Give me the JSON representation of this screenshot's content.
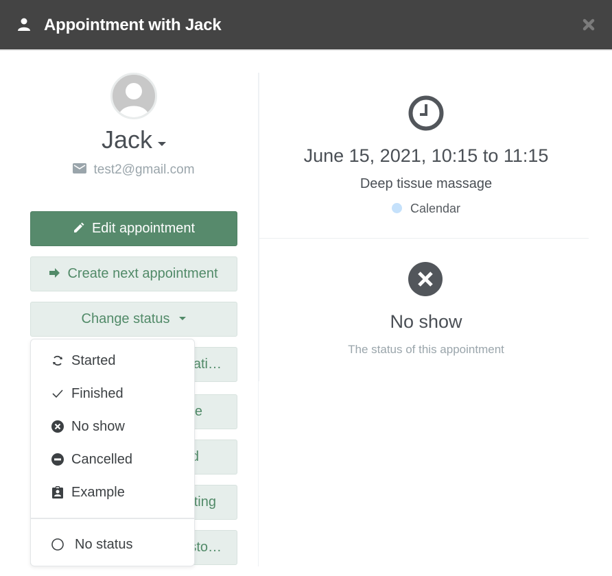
{
  "header": {
    "title": "Appointment with Jack",
    "icon": "user-icon",
    "close_icon": "close-icon"
  },
  "client": {
    "name": "Jack",
    "email": "test2@gmail.com",
    "avatar_icon": "avatar-placeholder-icon"
  },
  "actions": {
    "edit_label": "Edit appointment",
    "create_next_label": "Create next appointment",
    "change_status_label": "Change status",
    "hidden_buttons": [
      {
        "visible_fragment": "ati…"
      },
      {
        "visible_fragment": "ce"
      },
      {
        "visible_fragment": "d"
      },
      {
        "visible_fragment": "ting"
      },
      {
        "visible_fragment": "sto…"
      }
    ]
  },
  "status_menu": {
    "items": [
      {
        "label": "Started",
        "icon": "refresh-icon"
      },
      {
        "label": "Finished",
        "icon": "check-icon"
      },
      {
        "label": "No show",
        "icon": "circle-x-icon"
      },
      {
        "label": "Cancelled",
        "icon": "circle-minus-icon"
      },
      {
        "label": "Example",
        "icon": "badge-icon"
      }
    ],
    "no_status_label": "No status"
  },
  "details": {
    "datetime": "June 15, 2021, 10:15 to 11:15",
    "service": "Deep tissue massage",
    "calendar": "Calendar",
    "calendar_color": "#c5e1fb"
  },
  "status": {
    "title": "No show",
    "subtitle": "The status of this appointment"
  },
  "colors": {
    "header_bg": "#444444",
    "primary": "#578a6c",
    "secondary_bg": "#e6eeeb",
    "secondary_text": "#518a68"
  }
}
